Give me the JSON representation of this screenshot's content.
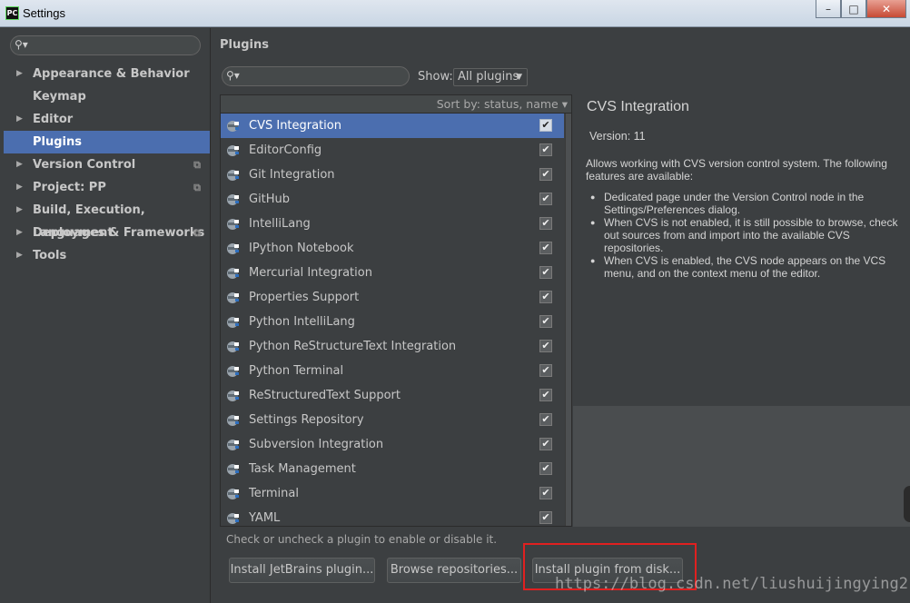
{
  "window": {
    "title": "Settings",
    "app_icon": "PC"
  },
  "sidebar": {
    "search_placeholder": "",
    "items": [
      {
        "label": "Appearance & Behavior",
        "arrow": true,
        "project_icon": false,
        "selected": false
      },
      {
        "label": "Keymap",
        "arrow": false,
        "project_icon": false,
        "selected": false
      },
      {
        "label": "Editor",
        "arrow": true,
        "project_icon": false,
        "selected": false
      },
      {
        "label": "Plugins",
        "arrow": false,
        "project_icon": false,
        "selected": true
      },
      {
        "label": "Version Control",
        "arrow": true,
        "project_icon": true,
        "selected": false
      },
      {
        "label": "Project: PP",
        "arrow": true,
        "project_icon": true,
        "selected": false
      },
      {
        "label": "Build, Execution, Deployment",
        "arrow": true,
        "project_icon": false,
        "selected": false
      },
      {
        "label": "Languages & Frameworks",
        "arrow": true,
        "project_icon": true,
        "selected": false
      },
      {
        "label": "Tools",
        "arrow": true,
        "project_icon": false,
        "selected": false
      }
    ]
  },
  "main": {
    "title": "Plugins",
    "search_placeholder": "",
    "show_label": "Show:",
    "show_value": "All plugins",
    "sort_label": "Sort by: status, name",
    "plugins": [
      {
        "name": "CVS Integration",
        "checked": true,
        "selected": true
      },
      {
        "name": "EditorConfig",
        "checked": true,
        "selected": false
      },
      {
        "name": "Git Integration",
        "checked": true,
        "selected": false
      },
      {
        "name": "GitHub",
        "checked": true,
        "selected": false
      },
      {
        "name": "IntelliLang",
        "checked": true,
        "selected": false
      },
      {
        "name": "IPython Notebook",
        "checked": true,
        "selected": false
      },
      {
        "name": "Mercurial Integration",
        "checked": true,
        "selected": false
      },
      {
        "name": "Properties Support",
        "checked": true,
        "selected": false
      },
      {
        "name": "Python IntelliLang",
        "checked": true,
        "selected": false
      },
      {
        "name": "Python ReStructureText Integration",
        "checked": true,
        "selected": false
      },
      {
        "name": "Python Terminal",
        "checked": true,
        "selected": false
      },
      {
        "name": "ReStructuredText Support",
        "checked": true,
        "selected": false
      },
      {
        "name": "Settings Repository",
        "checked": true,
        "selected": false
      },
      {
        "name": "Subversion Integration",
        "checked": true,
        "selected": false
      },
      {
        "name": "Task Management",
        "checked": true,
        "selected": false
      },
      {
        "name": "Terminal",
        "checked": true,
        "selected": false
      },
      {
        "name": "YAML",
        "checked": true,
        "selected": false
      }
    ],
    "hint": "Check or uncheck a plugin to enable or disable it."
  },
  "detail": {
    "title": "CVS Integration",
    "version": "Version: 11",
    "description": "Allows working with CVS version control system. The following features are available:",
    "bullets": [
      "Dedicated page under the Version Control node in the Settings/Preferences dialog.",
      "When CVS is not enabled, it is still possible to browse, check out sources from and import into the available CVS repositories.",
      "When CVS is enabled, the CVS node appears on the VCS menu, and on the context menu of the editor."
    ]
  },
  "buttons": {
    "install_jetbrains": "Install JetBrains plugin...",
    "browse_repositories": "Browse repositories...",
    "install_from_disk": "Install plugin from disk..."
  },
  "watermark": "https://blog.csdn.net/liushuijingying2",
  "colors": {
    "selection": "#4b6eaf",
    "background": "#3c3f41",
    "highlight_box": "#e02020"
  }
}
